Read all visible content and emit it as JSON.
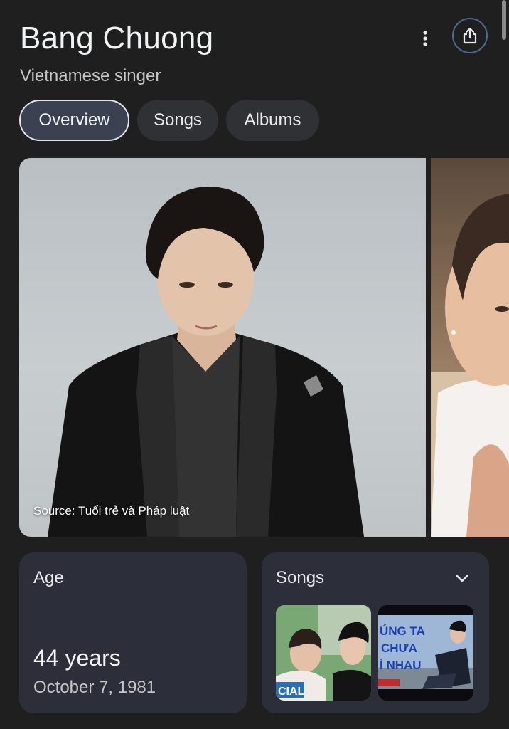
{
  "header": {
    "title": "Bang Chuong",
    "subtitle": "Vietnamese singer"
  },
  "tabs": [
    {
      "label": "Overview",
      "active": true
    },
    {
      "label": "Songs",
      "active": false
    },
    {
      "label": "Albums",
      "active": false
    }
  ],
  "gallery": {
    "source": "Source: Tuổi trẻ và Pháp luật"
  },
  "age_card": {
    "label": "Age",
    "value": "44 years",
    "birthdate": "October 7, 1981"
  },
  "songs_card": {
    "label": "Songs",
    "thumb2_text": [
      "ÚNG TA",
      "CHƯA",
      "Ì NHAU"
    ],
    "thumb1_text": "CIAL"
  },
  "icons": {
    "more": "more-vert-icon",
    "share": "share-icon",
    "expand": "chevron-down-icon"
  },
  "colors": {
    "background": "#1f1f1f",
    "card": "#2c2e3a",
    "active_tab": "#3b4150",
    "share_ring": "#4a6b96"
  }
}
